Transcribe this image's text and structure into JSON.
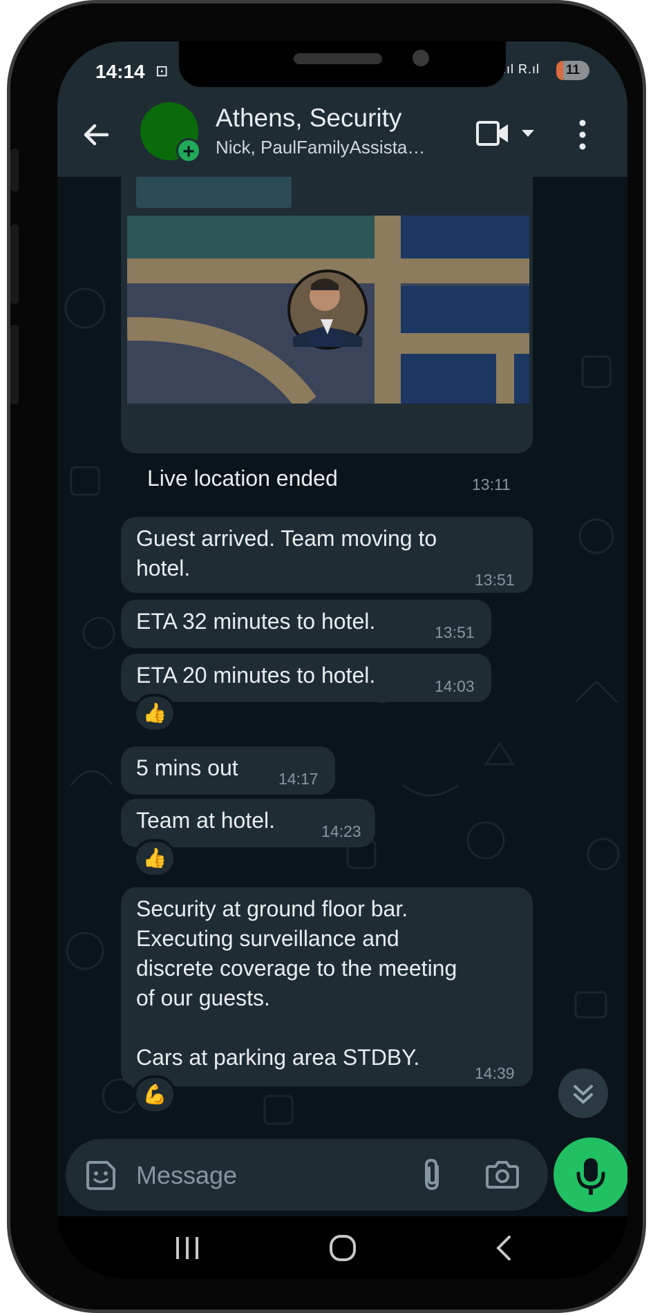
{
  "status_bar": {
    "time": "14:14",
    "battery": "11",
    "network": "R.ıl R.ıl"
  },
  "header": {
    "title": "Athens, Security",
    "subtitle": "Nick, PaulFamilyAssista…"
  },
  "messages": [
    {
      "type": "live_location",
      "caption": "Live location ended",
      "time": "13:11"
    },
    {
      "type": "text",
      "text": "Guest arrived. Team moving to\nhotel.",
      "time": "13:51"
    },
    {
      "type": "text",
      "text": "ETA 32 minutes to hotel.",
      "time": "13:51"
    },
    {
      "type": "text",
      "text": "ETA 20 minutes to hotel.",
      "time": "14:03",
      "reaction": "👍"
    },
    {
      "type": "text",
      "text": "5 mins out",
      "time": "14:17"
    },
    {
      "type": "text",
      "text": "Team at hotel.",
      "time": "14:23",
      "reaction": "👍"
    },
    {
      "type": "text",
      "text": "Security at ground floor bar.\nExecuting surveillance and\ndiscrete coverage to the meeting\nof our guests.\n\nCars at parking area STDBY.",
      "time": "14:39",
      "reaction": "💪"
    }
  ],
  "input": {
    "placeholder": "Message"
  },
  "colors": {
    "bubble": "#1f2c34",
    "background": "#0b141a",
    "accent_green": "#21c063",
    "time_text": "#8696a0"
  },
  "icons": [
    "back-arrow-icon",
    "video-call-icon",
    "more-vert-icon",
    "sticker-icon",
    "attach-icon",
    "camera-icon",
    "mic-icon",
    "chevron-double-down-icon"
  ]
}
